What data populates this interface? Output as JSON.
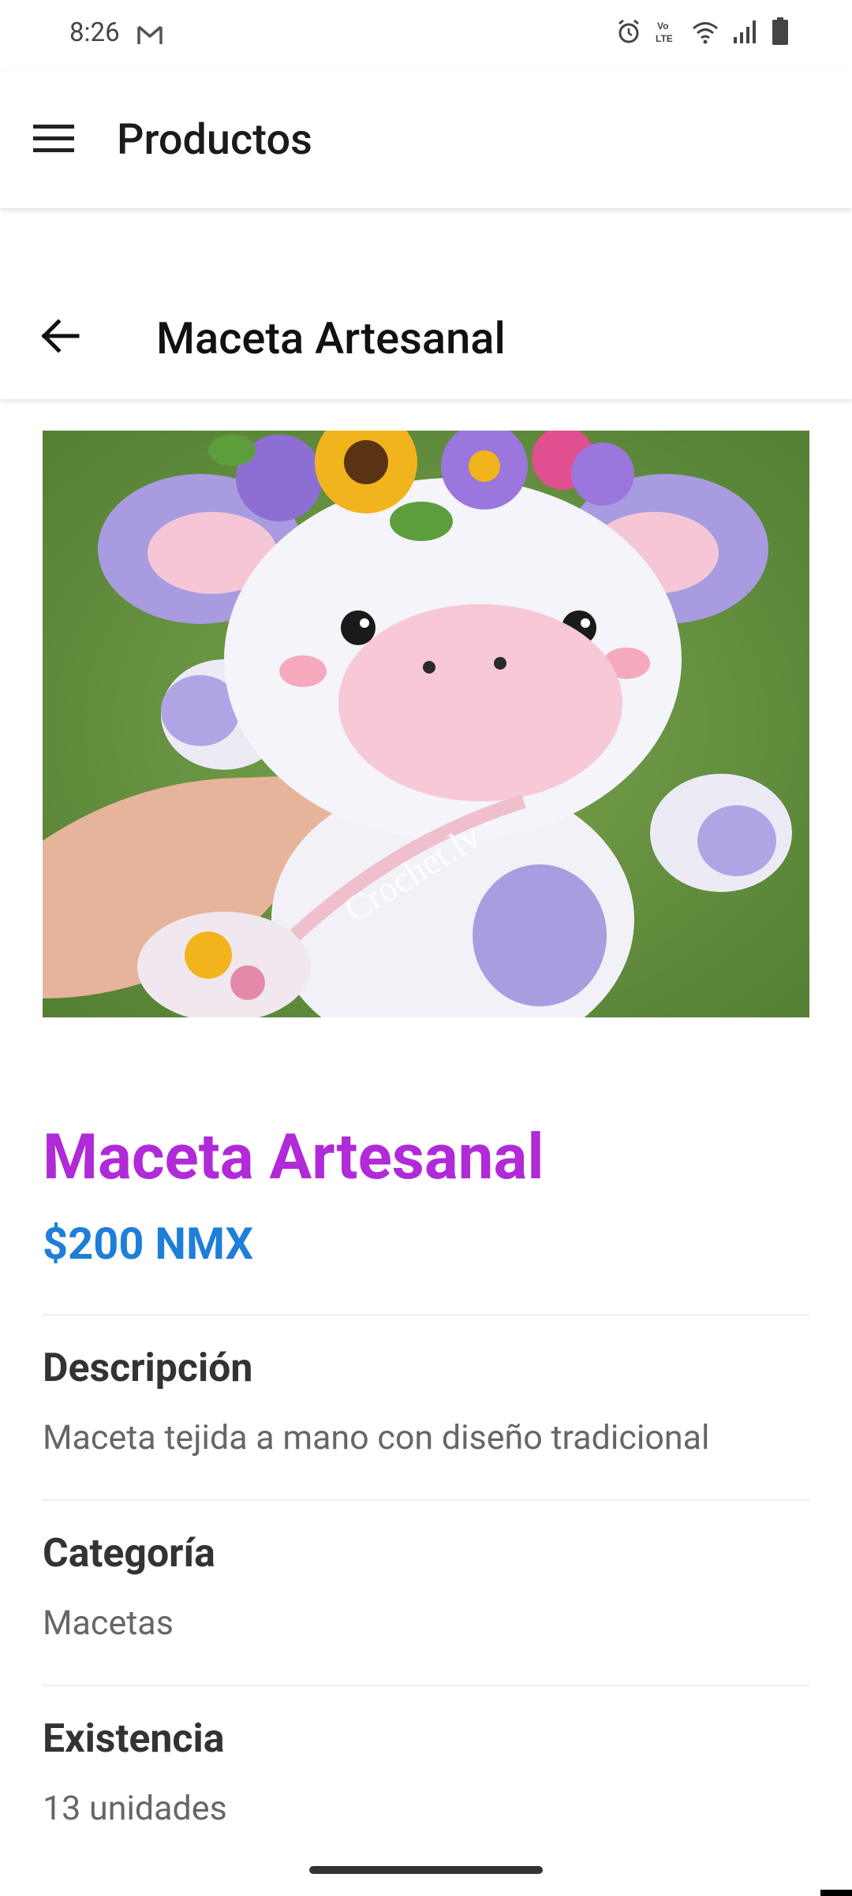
{
  "status_bar": {
    "time": "8:26",
    "icons": [
      "gmail-icon",
      "alarm-icon",
      "volte-icon",
      "wifi-icon",
      "signal-icon",
      "battery-icon"
    ]
  },
  "app_bar": {
    "title": "Productos",
    "menu_icon": "hamburger-menu-icon"
  },
  "detail_header": {
    "title": "Maceta Artesanal",
    "back_icon": "arrow-back-icon"
  },
  "product": {
    "image_watermark": "Crochet.lv",
    "name": "Maceta Artesanal",
    "price": "$200 NMX",
    "sections": [
      {
        "label": "Descripción",
        "value": "Maceta tejida a mano con diseño tradicional"
      },
      {
        "label": "Categoría",
        "value": "Macetas"
      },
      {
        "label": "Existencia",
        "value": "13 unidades"
      }
    ]
  },
  "colors": {
    "name": "#b02ad8",
    "price": "#1e7ed8",
    "label": "#333333",
    "value": "#666666"
  }
}
